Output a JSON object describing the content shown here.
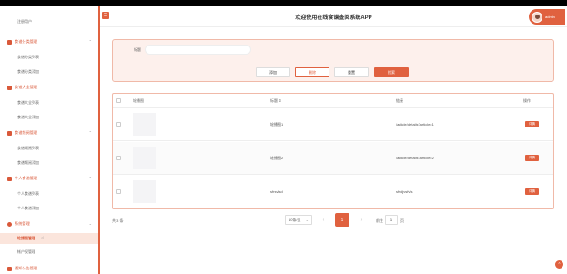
{
  "sidebar": {
    "items": [
      {
        "type": "sub",
        "label": "注册用户"
      },
      {
        "type": "group",
        "label": "食谱分类管理"
      },
      {
        "type": "sub",
        "label": "食谱分类列表"
      },
      {
        "type": "sub",
        "label": "食谱分类添加"
      },
      {
        "type": "group",
        "label": "食谱大全管理"
      },
      {
        "type": "sub",
        "label": "食谱大全列表"
      },
      {
        "type": "sub",
        "label": "食谱大全添加"
      },
      {
        "type": "group",
        "label": "食谱频阅管理"
      },
      {
        "type": "sub",
        "label": "食谱频阅列表"
      },
      {
        "type": "sub",
        "label": "食谱频阅添加"
      },
      {
        "type": "group",
        "label": "个人食谱管理"
      },
      {
        "type": "sub",
        "label": "个人食谱列表"
      },
      {
        "type": "sub",
        "label": "个人食谱添加"
      },
      {
        "type": "group",
        "label": "系统管理"
      },
      {
        "type": "active",
        "label": "轮播图管理"
      },
      {
        "type": "sub",
        "label": "帐户权管理"
      },
      {
        "type": "group",
        "label": "通知公告管理"
      }
    ]
  },
  "header": {
    "menu_icon": "☰",
    "title": "欢迎使用在线食谱查阅系统APP",
    "username": "admin"
  },
  "search": {
    "title_label": "标题",
    "title_value": "",
    "add_label": "添加",
    "delete_label": "删除",
    "reset_label": "重置",
    "search_label": "搜索"
  },
  "table": {
    "columns": [
      "轮播图",
      "标题 ⇕",
      "链接",
      "操作"
    ],
    "rows": [
      {
        "title": "轮播图1",
        "link": "/article/details?article=1",
        "action": "详情"
      },
      {
        "title": "轮播图2",
        "link": "/article/details?article=2",
        "action": "详情"
      },
      {
        "title": "sfrsvfsd",
        "link": "sfsdjvsfvfs",
        "action": "详情"
      }
    ]
  },
  "pagination": {
    "total": "共 3 条",
    "page_size": "10条/页",
    "prev": "‹",
    "current_page": "1",
    "next": "›",
    "goto_label": "前往",
    "goto_value": "1",
    "goto_suffix": "页"
  },
  "colors": {
    "accent": "#e0613f",
    "accent_light": "#fdf0ec"
  },
  "icons": {
    "scroll_top": "⌃"
  }
}
